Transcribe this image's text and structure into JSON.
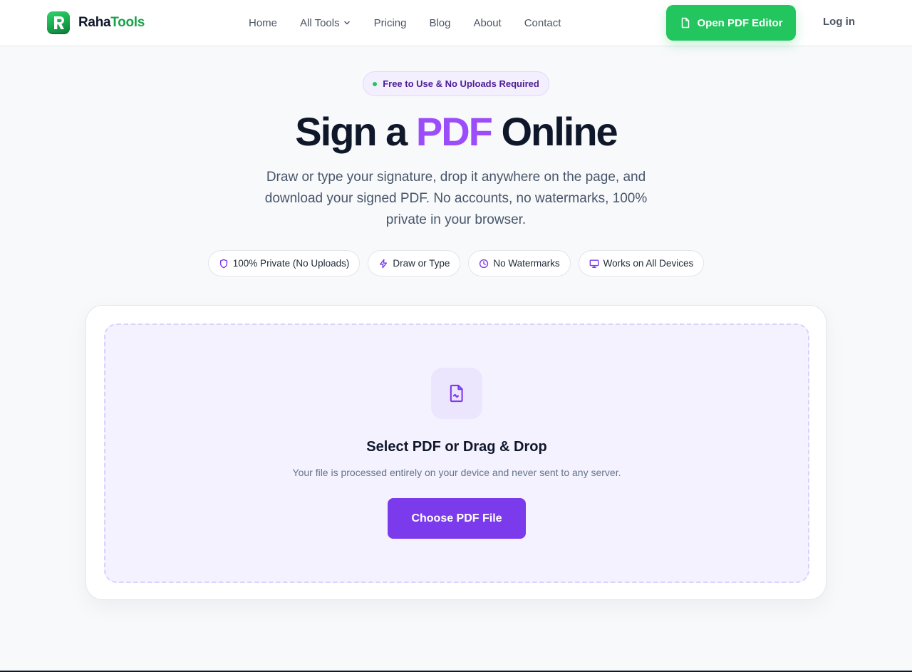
{
  "header": {
    "logo": {
      "part1": "Raha",
      "part2": "Tools",
      "icon": "raha-logo-icon"
    },
    "nav": [
      {
        "label": "Home"
      },
      {
        "label": "All Tools",
        "icon": "chevron-down-icon"
      },
      {
        "label": "Pricing"
      },
      {
        "label": "Blog"
      },
      {
        "label": "About"
      },
      {
        "label": "Contact"
      }
    ],
    "cta": {
      "label": "Open PDF Editor",
      "icon": "file-icon"
    },
    "login": "Log in"
  },
  "hero": {
    "badge": "Free to Use & No Uploads Required",
    "title_before": "Sign a ",
    "title_accent": "PDF",
    "title_after": " Online",
    "subtitle": "Draw or type your signature, drop it anywhere on the page, and download your signed PDF. No accounts, no watermarks, 100% private in your browser.",
    "features": [
      {
        "label": "100% Private (No Uploads)",
        "icon": "shield-icon"
      },
      {
        "label": "Draw or Type",
        "icon": "lightning-icon"
      },
      {
        "label": "No Watermarks",
        "icon": "clock-icon"
      },
      {
        "label": "Works on All Devices",
        "icon": "monitor-icon"
      }
    ]
  },
  "upload": {
    "icon": "file-signature-icon",
    "title": "Select PDF or Drag & Drop",
    "subtitle": "Your file is processed entirely on your device and never sent to any server.",
    "button": "Choose PDF File"
  },
  "colors": {
    "brand_green": "#22c55e",
    "accent_purple": "#9b4dfa",
    "button_purple": "#7c3aed",
    "dropzone_bg": "#f5f2ff"
  }
}
